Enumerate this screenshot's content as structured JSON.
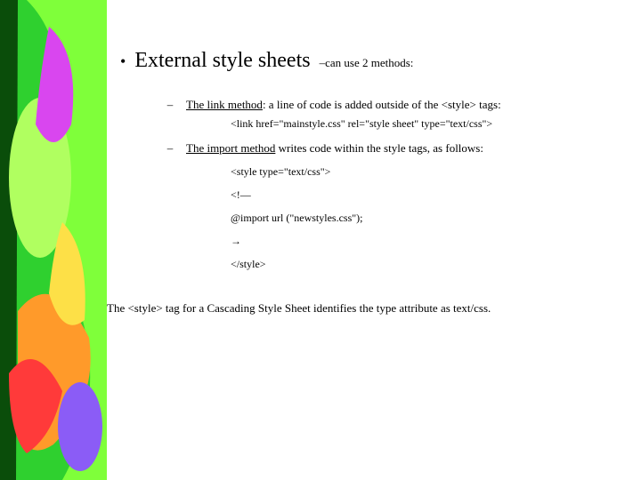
{
  "heading": {
    "bullet": "•",
    "main": "External style sheets",
    "sub": "–can use 2 methods:"
  },
  "items": [
    {
      "dash": "–",
      "label": "The link method",
      "desc": ": a line of code is added outside of the <style> tags:",
      "code": "<link href=\"mainstyle.css\" rel=\"style sheet\" type=\"text/css\">"
    },
    {
      "dash": "–",
      "label": "The import method",
      "desc": " writes code within the style tags, as follows:"
    }
  ],
  "codeblock": {
    "l1": "<style type=\"text/css\">",
    "l2": "<!—",
    "l3": "@import url (\"newstyles.css\");",
    "l4": "→",
    "l5": "</style>"
  },
  "footer": "The <style> tag for a Cascading Style Sheet identifies the type attribute as text/css."
}
